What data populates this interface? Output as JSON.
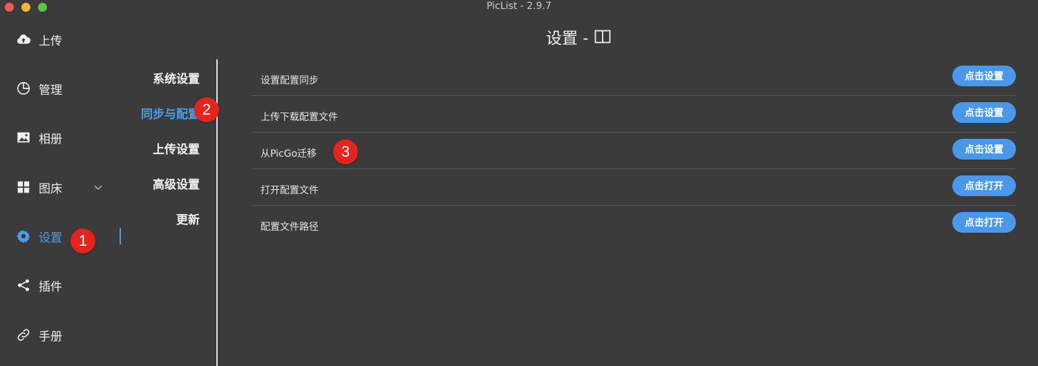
{
  "window": {
    "title": "PicList - 2.9.7"
  },
  "sidebar": {
    "items": [
      {
        "label": "上传",
        "icon": "cloud-upload-icon"
      },
      {
        "label": "管理",
        "icon": "pie-chart-icon"
      },
      {
        "label": "相册",
        "icon": "image-icon"
      },
      {
        "label": "图床",
        "icon": "grid-icon"
      },
      {
        "label": "设置",
        "icon": "gear-icon",
        "active": true
      },
      {
        "label": "插件",
        "icon": "share-icon"
      },
      {
        "label": "手册",
        "icon": "link-icon"
      }
    ]
  },
  "submenu": {
    "items": [
      {
        "label": "系统设置"
      },
      {
        "label": "同步与配置",
        "active": true
      },
      {
        "label": "上传设置"
      },
      {
        "label": "高级设置"
      },
      {
        "label": "更新"
      }
    ]
  },
  "page": {
    "title": "设置 -"
  },
  "rows": [
    {
      "label": "设置配置同步",
      "button": "点击设置"
    },
    {
      "label": "上传下载配置文件",
      "button": "点击设置"
    },
    {
      "label": "从PicGo迁移",
      "button": "点击设置"
    },
    {
      "label": "打开配置文件",
      "button": "点击打开"
    },
    {
      "label": "配置文件路径",
      "button": "点击打开"
    }
  ],
  "markers": [
    "1",
    "2",
    "3"
  ],
  "colors": {
    "accent": "#4d9ee8",
    "button": "#4a98ea",
    "marker": "#e5241d",
    "background": "#3b3b3b"
  }
}
